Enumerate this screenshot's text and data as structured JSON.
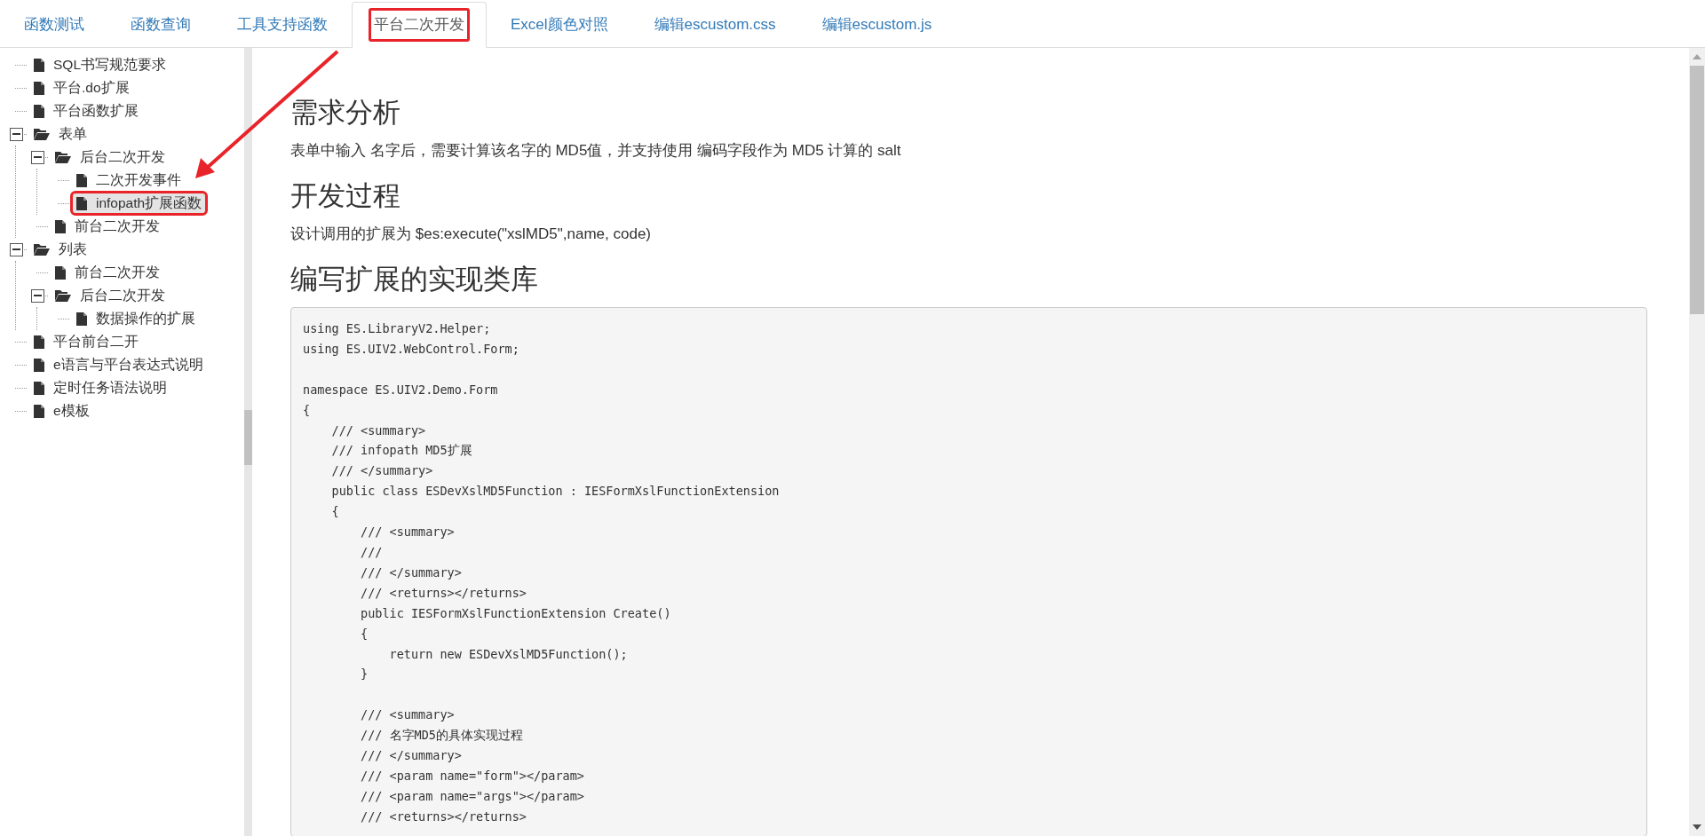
{
  "tabs": [
    {
      "label": "函数测试",
      "selected": false,
      "annotated": false
    },
    {
      "label": "函数查询",
      "selected": false,
      "annotated": false
    },
    {
      "label": "工具支持函数",
      "selected": false,
      "annotated": false
    },
    {
      "label": "平台二次开发",
      "selected": true,
      "annotated": true
    },
    {
      "label": "Excel颜色对照",
      "selected": false,
      "annotated": false
    },
    {
      "label": "编辑escustom.css",
      "selected": false,
      "annotated": false
    },
    {
      "label": "编辑escustom.js",
      "selected": false,
      "annotated": false
    }
  ],
  "tree": [
    {
      "label": "SQL书写规范要求",
      "kind": "file",
      "selected": false,
      "annotated": false
    },
    {
      "label": "平台.do扩展",
      "kind": "file",
      "selected": false,
      "annotated": false
    },
    {
      "label": "平台函数扩展",
      "kind": "file",
      "selected": false,
      "annotated": false
    },
    {
      "label": "表单",
      "kind": "folder",
      "expanded": true,
      "children": [
        {
          "label": "后台二次开发",
          "kind": "folder",
          "expanded": true,
          "children": [
            {
              "label": "二次开发事件",
              "kind": "file",
              "selected": false,
              "annotated": false
            },
            {
              "label": "infopath扩展函数",
              "kind": "file",
              "selected": true,
              "annotated": true
            }
          ]
        },
        {
          "label": "前台二次开发",
          "kind": "file",
          "selected": false,
          "annotated": false
        }
      ]
    },
    {
      "label": "列表",
      "kind": "folder",
      "expanded": true,
      "children": [
        {
          "label": "前台二次开发",
          "kind": "file",
          "selected": false,
          "annotated": false
        },
        {
          "label": "后台二次开发",
          "kind": "folder",
          "expanded": true,
          "children": [
            {
              "label": "数据操作的扩展",
              "kind": "file",
              "selected": false,
              "annotated": false
            }
          ]
        }
      ]
    },
    {
      "label": "平台前台二开",
      "kind": "file",
      "selected": false,
      "annotated": false
    },
    {
      "label": "e语言与平台表达式说明",
      "kind": "file",
      "selected": false,
      "annotated": false
    },
    {
      "label": "定时任务语法说明",
      "kind": "file",
      "selected": false,
      "annotated": false
    },
    {
      "label": "e模板",
      "kind": "file",
      "selected": false,
      "annotated": false
    }
  ],
  "annotation_arrow": true,
  "content": [
    {
      "kind": "heading",
      "text": "需求分析"
    },
    {
      "kind": "paragraph",
      "text": "表单中输入 名字后，需要计算该名字的 MD5值，并支持使用 编码字段作为 MD5 计算的 salt"
    },
    {
      "kind": "heading",
      "text": "开发过程"
    },
    {
      "kind": "paragraph",
      "text": "设计调用的扩展为 $es:execute(\"xslMD5\",name, code)"
    },
    {
      "kind": "heading",
      "text": "编写扩展的实现类库"
    },
    {
      "kind": "code",
      "text": "using ES.LibraryV2.Helper;\nusing ES.UIV2.WebControl.Form;\n\nnamespace ES.UIV2.Demo.Form\n{\n    /// <summary>\n    /// infopath MD5扩展\n    /// </summary>\n    public class ESDevXslMD5Function : IESFormXslFunctionExtension\n    {\n        /// <summary>\n        ///\n        /// </summary>\n        /// <returns></returns>\n        public IESFormXslFunctionExtension Create()\n        {\n            return new ESDevXslMD5Function();\n        }\n\n        /// <summary>\n        /// 名字MD5的具体实现过程\n        /// </summary>\n        /// <param name=\"form\"></param>\n        /// <param name=\"args\"></param>\n        /// <returns></returns>"
    }
  ]
}
